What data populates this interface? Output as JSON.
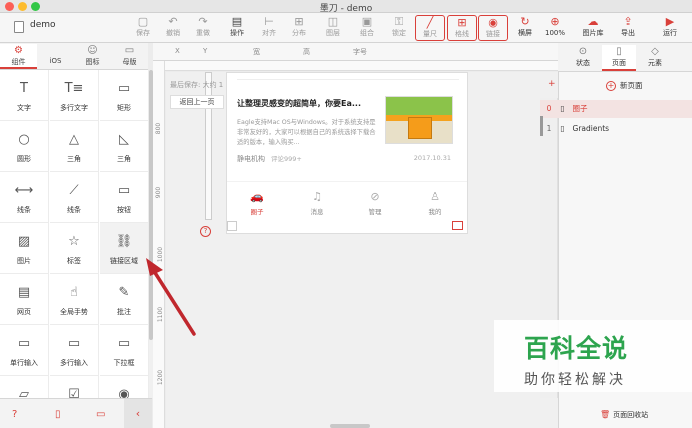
{
  "window": {
    "title": "墨刀 - demo",
    "doc_name": "demo"
  },
  "toolbar": {
    "items": [
      {
        "label": "保存",
        "icon": "save-icon",
        "glyph": "▢",
        "state": "disabled"
      },
      {
        "label": "撤销",
        "icon": "undo-icon",
        "glyph": "↶",
        "state": "disabled"
      },
      {
        "label": "重做",
        "icon": "redo-icon",
        "glyph": "↷",
        "state": "disabled"
      },
      {
        "label": "操作",
        "icon": "operate-icon",
        "glyph": "▤",
        "state": "normal"
      },
      {
        "label": "对齐",
        "icon": "align-icon",
        "glyph": "⊢",
        "state": "disabled"
      },
      {
        "label": "分布",
        "icon": "distribute-icon",
        "glyph": "⊞",
        "state": "disabled"
      },
      {
        "label": "图层",
        "icon": "layers-icon",
        "glyph": "◫",
        "state": "disabled"
      },
      {
        "label": "组合",
        "icon": "group-icon",
        "glyph": "▣",
        "state": "disabled"
      },
      {
        "label": "锁定",
        "icon": "lock-icon",
        "glyph": "⚿",
        "state": "disabled"
      },
      {
        "label": "量尺",
        "icon": "ruler-icon",
        "glyph": "╱",
        "state": "boxed"
      },
      {
        "label": "格线",
        "icon": "grid-icon",
        "glyph": "⊞",
        "state": "boxed"
      },
      {
        "label": "链接",
        "icon": "eye-icon",
        "glyph": "◉",
        "state": "boxed"
      },
      {
        "label": "横屏",
        "icon": "rotate-icon",
        "glyph": "↻",
        "state": "normal"
      },
      {
        "label": "100%",
        "icon": "zoom-icon",
        "glyph": "⊕",
        "state": "normal"
      },
      {
        "label": "图片库",
        "icon": "image-library-icon",
        "glyph": "☁",
        "state": "normal"
      },
      {
        "label": "导出",
        "icon": "export-icon",
        "glyph": "⇪",
        "state": "normal"
      },
      {
        "label": "运行",
        "icon": "run-icon",
        "glyph": "▶",
        "state": "normal"
      }
    ]
  },
  "left_tabs": [
    {
      "label": "组件",
      "icon": "components-icon",
      "glyph": "⚙",
      "active": true
    },
    {
      "label": "iOS",
      "icon": "apple-icon",
      "glyph": "",
      "active": false
    },
    {
      "label": "图标",
      "icon": "smiley-icon",
      "glyph": "☺",
      "active": false
    },
    {
      "label": "母版",
      "icon": "master-icon",
      "glyph": "▭",
      "active": false
    }
  ],
  "components": [
    {
      "label": "文字",
      "icon": "text-icon",
      "glyph": "T"
    },
    {
      "label": "多行文字",
      "icon": "multiline-text-icon",
      "glyph": "T≡"
    },
    {
      "label": "矩形",
      "icon": "rectangle-icon",
      "glyph": "▭"
    },
    {
      "label": "圆形",
      "icon": "circle-icon",
      "glyph": "○"
    },
    {
      "label": "三角",
      "icon": "triangle-icon",
      "glyph": "△"
    },
    {
      "label": "三角",
      "icon": "right-triangle-icon",
      "glyph": "◺"
    },
    {
      "label": "线条",
      "icon": "line-icon",
      "glyph": "⟷"
    },
    {
      "label": "线条",
      "icon": "diagonal-line-icon",
      "glyph": "⟋"
    },
    {
      "label": "按钮",
      "icon": "button-icon",
      "glyph": "▭"
    },
    {
      "label": "图片",
      "icon": "image-icon",
      "glyph": "▨"
    },
    {
      "label": "标签",
      "icon": "star-icon",
      "glyph": "☆"
    },
    {
      "label": "链接区域",
      "icon": "link-area-icon",
      "glyph": "⛓",
      "highlighted": true
    },
    {
      "label": "网页",
      "icon": "webpage-icon",
      "glyph": "▤"
    },
    {
      "label": "全局手势",
      "icon": "gesture-icon",
      "glyph": "☝"
    },
    {
      "label": "批注",
      "icon": "note-icon",
      "glyph": "✎"
    },
    {
      "label": "单行输入",
      "icon": "single-input-icon",
      "glyph": "▭"
    },
    {
      "label": "多行输入",
      "icon": "multi-input-icon",
      "glyph": "▭"
    },
    {
      "label": "下拉框",
      "icon": "dropdown-icon",
      "glyph": "▭"
    },
    {
      "label": "",
      "icon": "folder-icon",
      "glyph": "▱"
    },
    {
      "label": "",
      "icon": "checkbox-icon",
      "glyph": "☑"
    },
    {
      "label": "",
      "icon": "radio-icon",
      "glyph": "◉"
    }
  ],
  "left_bottom": {
    "help_icon": "help-icon",
    "doc_icon": "document-icon",
    "screen_icon": "screen-icon",
    "collapse_glyph": "‹"
  },
  "properties": [
    "X",
    "Y",
    "宽",
    "高",
    "字号"
  ],
  "ruler_numbers": [
    "800",
    "900",
    "1000",
    "1100",
    "1200"
  ],
  "canvas": {
    "autosave": "最后保存: 大约 1",
    "back_button": "返回上一页",
    "article": {
      "title": "让整理灵感变的超简单，你要Ea...",
      "desc": "Eagle支持Mac OS与Windows。对于系统支持是非常友好的，大家可以根据自己的系统选择下载合适的版本，输入购买...",
      "author": "静电机构",
      "comments": "评论999+",
      "date": "2017.10.31"
    },
    "nav": [
      {
        "label": "圈子",
        "icon": "car-icon",
        "glyph": "🚗",
        "active": true
      },
      {
        "label": "消息",
        "icon": "bell-icon",
        "glyph": "♫",
        "active": false
      },
      {
        "label": "管理",
        "icon": "compass-icon",
        "glyph": "⊘",
        "active": false
      },
      {
        "label": "我的",
        "icon": "person-icon",
        "glyph": "♙",
        "active": false
      }
    ]
  },
  "right_tabs": [
    {
      "label": "状态",
      "icon": "state-icon",
      "glyph": "⊙",
      "active": false
    },
    {
      "label": "页面",
      "icon": "page-icon",
      "glyph": "▯",
      "active": true
    },
    {
      "label": "元素",
      "icon": "element-icon",
      "glyph": "◇",
      "active": false
    }
  ],
  "right_panel": {
    "add_page": "新页面",
    "pages": [
      {
        "num": "0",
        "name": "圈子",
        "active": true
      },
      {
        "num": "1",
        "name": "Gradients",
        "active": false
      }
    ],
    "trash": "页面回收站"
  },
  "watermark": {
    "main": "百科全说",
    "sub": "助你轻松解决"
  },
  "colors": {
    "accent": "#d9403a",
    "watermark_green": "#2da44e"
  }
}
